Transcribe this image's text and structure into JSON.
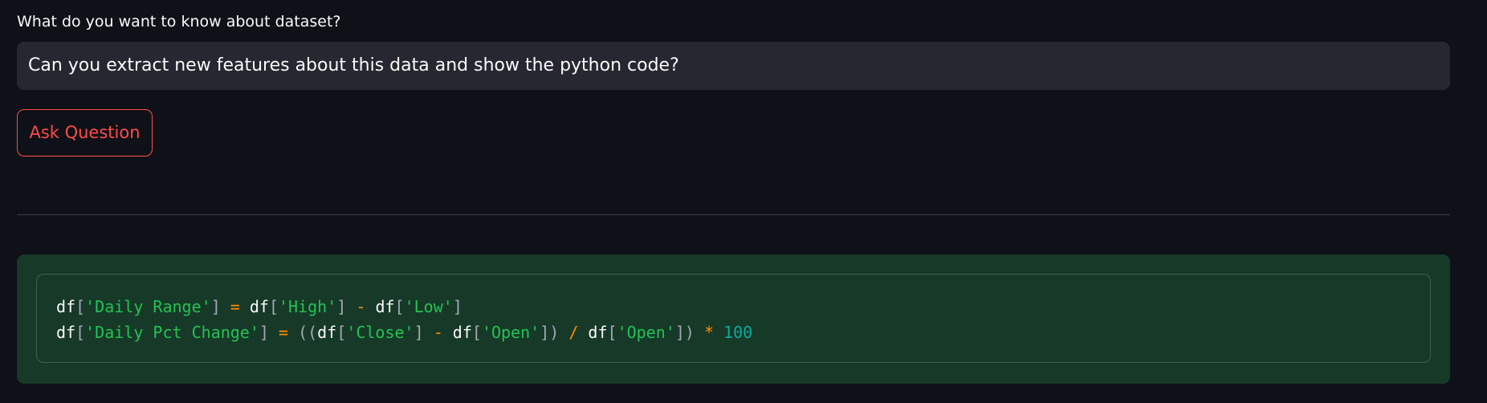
{
  "question_section": {
    "label": "What do you want to know about dataset?",
    "input_value": "Can you extract new features about this data and show the python code?"
  },
  "ask_button": {
    "label": "Ask Question"
  },
  "code_result": {
    "language": "python",
    "lines": [
      [
        {
          "t": "df",
          "k": "name"
        },
        {
          "t": "[",
          "k": "punc"
        },
        {
          "t": "'Daily Range'",
          "k": "str"
        },
        {
          "t": "]",
          "k": "punc"
        },
        {
          "t": " ",
          "k": "name"
        },
        {
          "t": "=",
          "k": "op"
        },
        {
          "t": " ",
          "k": "name"
        },
        {
          "t": "df",
          "k": "name"
        },
        {
          "t": "[",
          "k": "punc"
        },
        {
          "t": "'High'",
          "k": "str"
        },
        {
          "t": "]",
          "k": "punc"
        },
        {
          "t": " ",
          "k": "name"
        },
        {
          "t": "-",
          "k": "op"
        },
        {
          "t": " ",
          "k": "name"
        },
        {
          "t": "df",
          "k": "name"
        },
        {
          "t": "[",
          "k": "punc"
        },
        {
          "t": "'Low'",
          "k": "str"
        },
        {
          "t": "]",
          "k": "punc"
        }
      ],
      [
        {
          "t": "df",
          "k": "name"
        },
        {
          "t": "[",
          "k": "punc"
        },
        {
          "t": "'Daily Pct Change'",
          "k": "str"
        },
        {
          "t": "]",
          "k": "punc"
        },
        {
          "t": " ",
          "k": "name"
        },
        {
          "t": "=",
          "k": "op"
        },
        {
          "t": " ",
          "k": "name"
        },
        {
          "t": "((",
          "k": "punc"
        },
        {
          "t": "df",
          "k": "name"
        },
        {
          "t": "[",
          "k": "punc"
        },
        {
          "t": "'Close'",
          "k": "str"
        },
        {
          "t": "]",
          "k": "punc"
        },
        {
          "t": " ",
          "k": "name"
        },
        {
          "t": "-",
          "k": "op"
        },
        {
          "t": " ",
          "k": "name"
        },
        {
          "t": "df",
          "k": "name"
        },
        {
          "t": "[",
          "k": "punc"
        },
        {
          "t": "'Open'",
          "k": "str"
        },
        {
          "t": "])",
          "k": "punc"
        },
        {
          "t": " ",
          "k": "name"
        },
        {
          "t": "/",
          "k": "op"
        },
        {
          "t": " ",
          "k": "name"
        },
        {
          "t": "df",
          "k": "name"
        },
        {
          "t": "[",
          "k": "punc"
        },
        {
          "t": "'Open'",
          "k": "str"
        },
        {
          "t": "])",
          "k": "punc"
        },
        {
          "t": " ",
          "k": "name"
        },
        {
          "t": "*",
          "k": "op"
        },
        {
          "t": " ",
          "k": "name"
        },
        {
          "t": "100",
          "k": "num"
        }
      ]
    ]
  },
  "colors": {
    "background": "#0e1117",
    "input_background": "#262730",
    "accent": "#ff4b4b",
    "code_panel_background": "#173928",
    "string_token": "#21c354",
    "operator_token": "#ff8c00",
    "number_token": "#09ab9f"
  }
}
